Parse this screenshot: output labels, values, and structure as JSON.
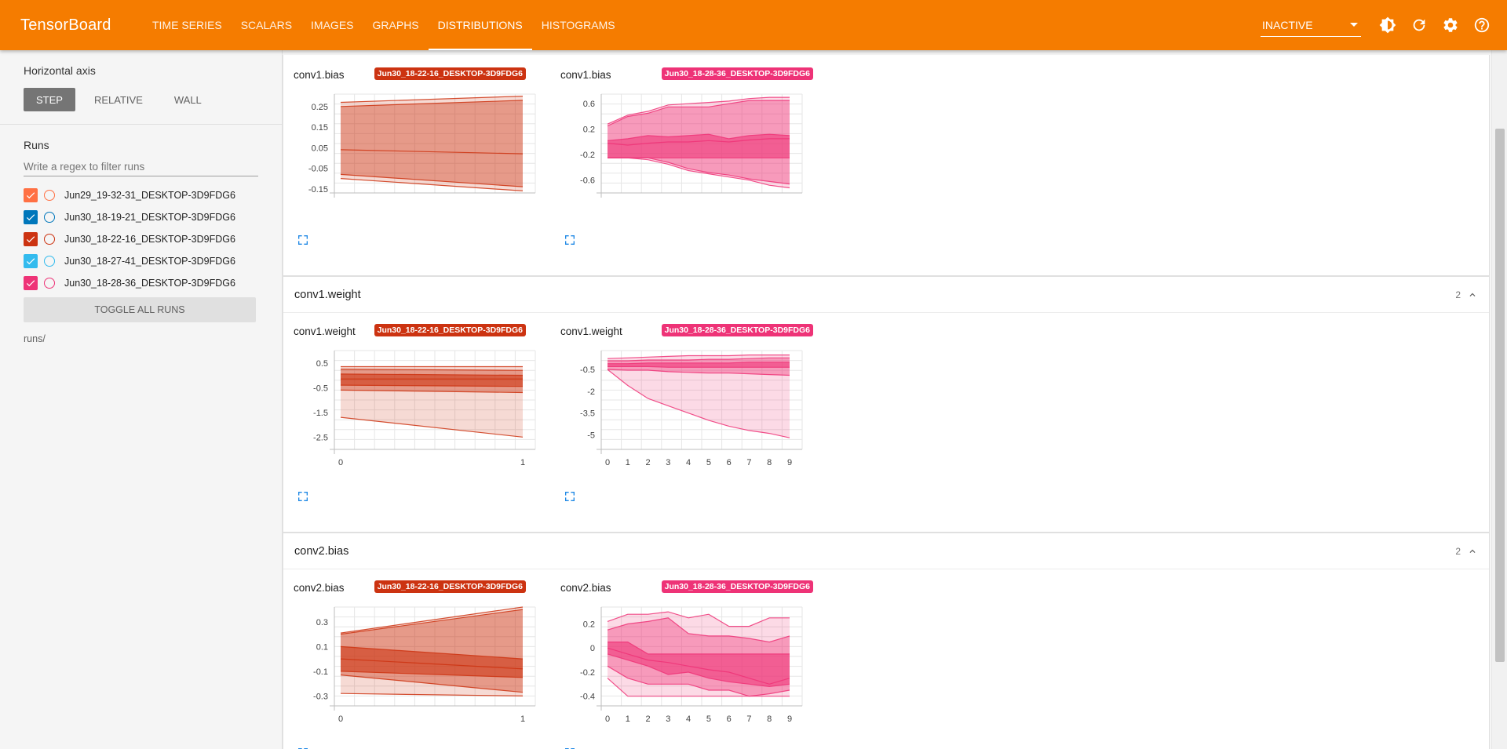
{
  "app": {
    "title": "TensorBoard"
  },
  "nav": {
    "tabs": [
      {
        "label": "TIME SERIES"
      },
      {
        "label": "SCALARS"
      },
      {
        "label": "IMAGES"
      },
      {
        "label": "GRAPHS"
      },
      {
        "label": "DISTRIBUTIONS",
        "active": true
      },
      {
        "label": "HISTOGRAMS"
      }
    ],
    "status_select": "INACTIVE"
  },
  "sidebar": {
    "horizontal_axis": {
      "title": "Horizontal axis",
      "options": [
        {
          "label": "STEP",
          "active": true
        },
        {
          "label": "RELATIVE"
        },
        {
          "label": "WALL"
        }
      ]
    },
    "runs": {
      "title": "Runs",
      "filter_placeholder": "Write a regex to filter runs",
      "items": [
        {
          "name": "Jun29_19-32-31_DESKTOP-3D9FDG6",
          "color": "#ff7043",
          "checked": true
        },
        {
          "name": "Jun30_18-19-21_DESKTOP-3D9FDG6",
          "color": "#0077bb",
          "checked": true
        },
        {
          "name": "Jun30_18-22-16_DESKTOP-3D9FDG6",
          "color": "#cc3311",
          "checked": true
        },
        {
          "name": "Jun30_18-27-41_DESKTOP-3D9FDG6",
          "color": "#33bbee",
          "checked": true
        },
        {
          "name": "Jun30_18-28-36_DESKTOP-3D9FDG6",
          "color": "#ee3377",
          "checked": true
        }
      ],
      "toggle_label": "TOGGLE ALL RUNS",
      "logdir": "runs/"
    }
  },
  "groups": [
    {
      "name": "conv1.bias",
      "count": ""
    },
    {
      "name": "conv1.weight",
      "count": "2"
    },
    {
      "name": "conv2.bias",
      "count": "2"
    }
  ],
  "chart_data": [
    {
      "type": "area",
      "title": "conv1.bias",
      "run": "Jun30_18-22-16_DESKTOP-3D9FDG6",
      "color": "#cc3311",
      "x": [
        0,
        1
      ],
      "xticks": [],
      "ylim": [
        -0.17,
        0.31
      ],
      "yticks": [
        0.25,
        0.15,
        0.05,
        -0.05,
        -0.15
      ],
      "bands": [
        [
          -0.1,
          -0.16
        ],
        [
          -0.08,
          -0.14
        ],
        [
          0.04,
          0.02
        ],
        [
          0.25,
          0.28
        ],
        [
          0.27,
          0.3
        ]
      ]
    },
    {
      "type": "area",
      "title": "conv1.bias",
      "run": "Jun30_18-28-36_DESKTOP-3D9FDG6",
      "color": "#ee3377",
      "x": [
        0,
        1,
        2,
        3,
        4,
        5,
        6,
        7,
        8,
        9
      ],
      "xticks": [],
      "ylim": [
        -0.8,
        0.75
      ],
      "yticks": [
        0.6,
        0.2,
        -0.2,
        -0.6
      ],
      "bands": [
        [
          -0.25,
          -0.25,
          -0.28,
          -0.35,
          -0.45,
          -0.5,
          -0.55,
          -0.6,
          -0.68,
          -0.72
        ],
        [
          -0.25,
          -0.25,
          -0.25,
          -0.32,
          -0.42,
          -0.48,
          -0.52,
          -0.58,
          -0.62,
          -0.66
        ],
        [
          -0.25,
          -0.25,
          -0.25,
          -0.25,
          -0.25,
          -0.25,
          -0.25,
          -0.25,
          -0.25,
          -0.25
        ],
        [
          -0.02,
          -0.05,
          -0.02,
          0.0,
          0.0,
          0.02,
          0.0,
          0.03,
          0.05,
          0.05
        ],
        [
          0.02,
          0.05,
          0.1,
          0.08,
          0.1,
          0.12,
          0.05,
          0.1,
          0.12,
          0.1
        ],
        [
          0.25,
          0.4,
          0.45,
          0.55,
          0.55,
          0.55,
          0.6,
          0.65,
          0.65,
          0.65
        ],
        [
          0.28,
          0.42,
          0.48,
          0.58,
          0.6,
          0.62,
          0.64,
          0.68,
          0.7,
          0.7
        ]
      ]
    },
    {
      "type": "area",
      "title": "conv1.weight",
      "run": "Jun30_18-22-16_DESKTOP-3D9FDG6",
      "color": "#cc3311",
      "x": [
        0,
        1
      ],
      "xticks": [
        0,
        1
      ],
      "ylim": [
        -3.0,
        1.0
      ],
      "yticks": [
        0.5,
        -0.5,
        -1.5,
        -2.5
      ],
      "bands": [
        [
          -1.7,
          -2.5
        ],
        [
          -0.6,
          -0.7
        ],
        [
          -0.4,
          -0.45
        ],
        [
          -0.15,
          -0.15
        ],
        [
          0.05,
          0.0
        ],
        [
          0.25,
          0.2
        ],
        [
          0.35,
          0.35
        ]
      ]
    },
    {
      "type": "area",
      "title": "conv1.weight",
      "run": "Jun30_18-28-36_DESKTOP-3D9FDG6",
      "color": "#ee3377",
      "x": [
        0,
        1,
        2,
        3,
        4,
        5,
        6,
        7,
        8,
        9
      ],
      "xticks": [
        0,
        1,
        2,
        3,
        4,
        5,
        6,
        7,
        8,
        9
      ],
      "ylim": [
        -6.0,
        0.8
      ],
      "yticks": [
        -0.5,
        -2,
        -3.5,
        -5
      ],
      "bands": [
        [
          -0.5,
          -1.6,
          -2.5,
          -3.0,
          -3.5,
          -4.0,
          -4.4,
          -4.7,
          -4.9,
          -5.2
        ],
        [
          -0.5,
          -0.55,
          -0.55,
          -0.65,
          -0.7,
          -0.75,
          -0.75,
          -0.8,
          -0.85,
          -0.9
        ],
        [
          -0.3,
          -0.3,
          -0.3,
          -0.35,
          -0.35,
          -0.35,
          -0.35,
          -0.35,
          -0.35,
          -0.35
        ],
        [
          -0.1,
          -0.1,
          -0.05,
          -0.05,
          -0.05,
          -0.05,
          -0.05,
          0.0,
          0.0,
          0.0
        ],
        [
          0.1,
          0.1,
          0.15,
          0.15,
          0.15,
          0.2,
          0.2,
          0.25,
          0.3,
          0.3
        ],
        [
          0.25,
          0.3,
          0.35,
          0.4,
          0.45,
          0.45,
          0.45,
          0.5,
          0.5,
          0.5
        ]
      ]
    },
    {
      "type": "area",
      "title": "conv2.bias",
      "run": "Jun30_18-22-16_DESKTOP-3D9FDG6",
      "color": "#cc3311",
      "x": [
        0,
        1
      ],
      "xticks": [
        0,
        1
      ],
      "ylim": [
        -0.38,
        0.42
      ],
      "yticks": [
        0.3,
        0.1,
        -0.1,
        -0.3
      ],
      "bands": [
        [
          -0.28,
          -0.3
        ],
        [
          -0.13,
          -0.27
        ],
        [
          -0.1,
          -0.15
        ],
        [
          0.0,
          -0.08
        ],
        [
          0.1,
          0.0
        ],
        [
          0.2,
          0.4
        ],
        [
          0.21,
          0.42
        ]
      ]
    },
    {
      "type": "area",
      "title": "conv2.bias",
      "run": "Jun30_18-28-36_DESKTOP-3D9FDG6",
      "color": "#ee3377",
      "x": [
        0,
        1,
        2,
        3,
        4,
        5,
        6,
        7,
        8,
        9
      ],
      "xticks": [
        0,
        1,
        2,
        3,
        4,
        5,
        6,
        7,
        8,
        9
      ],
      "ylim": [
        -0.48,
        0.34
      ],
      "yticks": [
        0.2,
        0,
        -0.2,
        -0.4
      ],
      "bands": [
        [
          -0.25,
          -0.4,
          -0.4,
          -0.4,
          -0.4,
          -0.4,
          -0.4,
          -0.4,
          -0.4,
          -0.4
        ],
        [
          -0.15,
          -0.25,
          -0.3,
          -0.3,
          -0.3,
          -0.35,
          -0.35,
          -0.4,
          -0.38,
          -0.35
        ],
        [
          -0.05,
          -0.1,
          -0.15,
          -0.22,
          -0.2,
          -0.25,
          -0.28,
          -0.3,
          -0.32,
          -0.3
        ],
        [
          0.0,
          -0.05,
          -0.1,
          -0.12,
          -0.15,
          -0.18,
          -0.2,
          -0.25,
          -0.3,
          -0.25
        ],
        [
          0.05,
          0.05,
          -0.05,
          -0.05,
          -0.05,
          -0.05,
          -0.05,
          -0.05,
          -0.05,
          -0.05
        ],
        [
          0.15,
          0.2,
          0.22,
          0.25,
          0.12,
          0.1,
          0.1,
          0.08,
          0.05,
          0.1
        ],
        [
          0.22,
          0.28,
          0.28,
          0.3,
          0.25,
          0.28,
          0.18,
          0.18,
          0.25,
          0.25
        ]
      ]
    }
  ]
}
